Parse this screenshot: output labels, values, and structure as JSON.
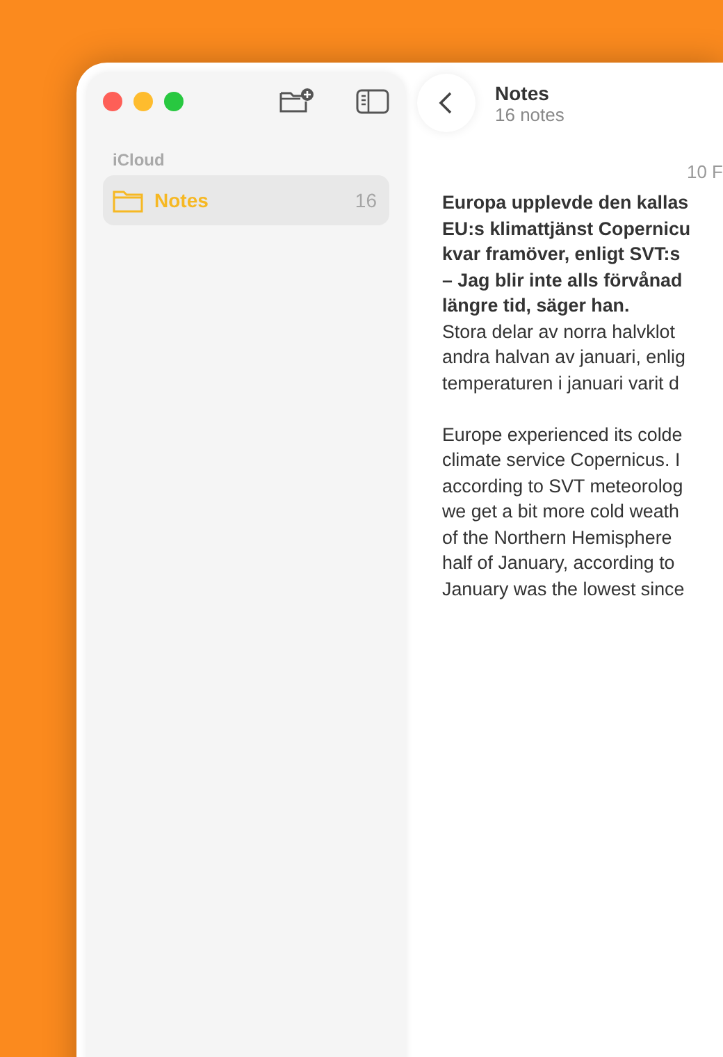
{
  "sidebar": {
    "section": "iCloud",
    "folders": [
      {
        "name": "Notes",
        "count": "16",
        "selected": true
      }
    ]
  },
  "header": {
    "title": "Notes",
    "subtitle": "16 notes"
  },
  "note": {
    "date": "10 F",
    "bold_lines": [
      "Europa upplevde den kallas",
      "EU:s klimattjänst Copernicu",
      "kvar framöver, enligt SVT:s",
      "– Jag blir inte alls förvånad",
      "längre tid, säger han."
    ],
    "lines": [
      "Stora delar av norra halvklot",
      "andra halvan av januari, enlig",
      "temperaturen i januari varit d"
    ],
    "english_lines": [
      "Europe experienced its colde",
      "climate service Copernicus. I",
      "according to SVT meteorolog",
      "we get a bit more cold weath",
      "of the Northern Hemisphere",
      "half of January, according to",
      "January was the lowest since"
    ]
  }
}
